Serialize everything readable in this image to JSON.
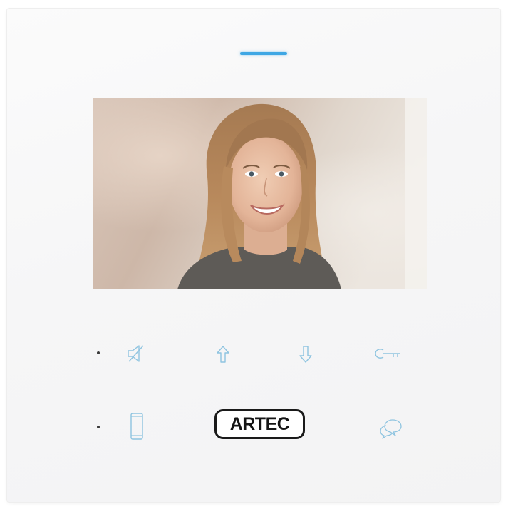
{
  "device": {
    "brand_logo_text": "ARTEC",
    "led_color": "#3fa7e4",
    "icon_color": "#8ec4e0",
    "screen_content": "video-feed-visitor"
  },
  "keys": {
    "row1": [
      {
        "name": "mute",
        "icon": "speaker-muted-icon"
      },
      {
        "name": "up",
        "icon": "arrow-up-icon"
      },
      {
        "name": "down",
        "icon": "arrow-down-icon"
      },
      {
        "name": "door-release",
        "icon": "key-icon"
      }
    ],
    "row2": [
      {
        "name": "handset",
        "icon": "mobile-phone-icon"
      },
      {
        "name": "intercom",
        "icon": "chat-bubbles-icon"
      }
    ]
  }
}
